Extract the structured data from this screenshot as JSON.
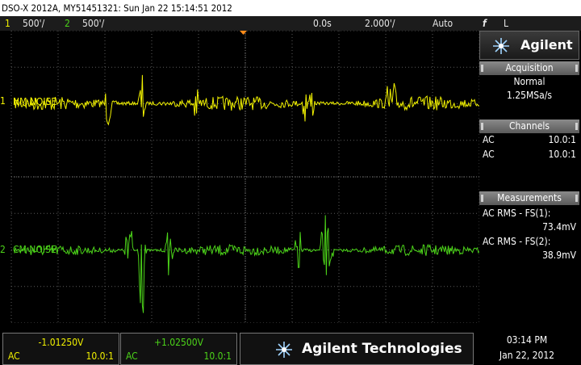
{
  "title": "DSO-X 2012A, MY51451321: Sun Jan 22 15:14:51 2012",
  "status": {
    "ch1_num": "1",
    "ch1_scale": "500'/",
    "ch2_num": "2",
    "ch2_scale": "500'/",
    "time_delay": "0.0s",
    "time_scale": "2.000'/",
    "trigger_mode": "Auto",
    "trigger_icon": "f",
    "trigger_level": "L"
  },
  "traces": {
    "ch1_label": "NM NOISE",
    "ch2_label": "CM NOISE",
    "ch1_marker": "1",
    "ch2_marker": "2",
    "ch1_color": "#f2f200",
    "ch2_color": "#4cd419"
  },
  "side": {
    "brand": "Agilent",
    "acquisition": {
      "header": "Acquisition",
      "mode": "Normal",
      "rate": "1.25MSa/s"
    },
    "channels": {
      "header": "Channels",
      "rows": [
        {
          "coupling": "AC",
          "probe": "10.0:1"
        },
        {
          "coupling": "AC",
          "probe": "10.0:1"
        }
      ]
    },
    "measurements": {
      "header": "Measurements",
      "items": [
        {
          "label": "AC RMS - FS(1):",
          "value": "73.4mV"
        },
        {
          "label": "AC RMS - FS(2):",
          "value": "38.9mV"
        }
      ]
    }
  },
  "bottom": {
    "ch1": {
      "offset": "-1.01250V",
      "coupling": "AC",
      "probe": "10.0:1"
    },
    "ch2": {
      "offset": "+1.02500V",
      "coupling": "AC",
      "probe": "10.0:1"
    },
    "logo_text": "Agilent Technologies",
    "time": "03:14 PM",
    "date": "Jan 22, 2012"
  }
}
